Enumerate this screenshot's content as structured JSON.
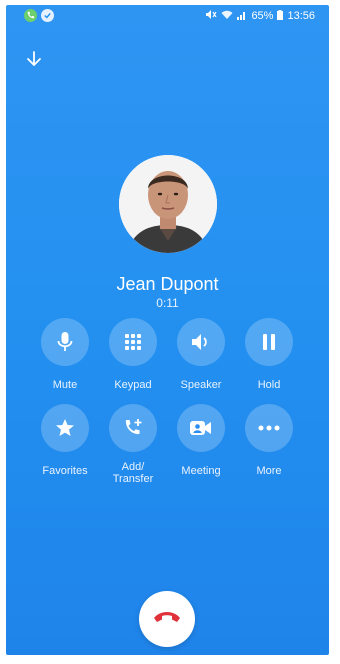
{
  "status_bar": {
    "battery": "65%",
    "time": "13:56"
  },
  "caller": {
    "name": "Jean Dupont",
    "duration": "0:11"
  },
  "controls_row1": [
    {
      "label": "Mute",
      "icon": "microphone-icon"
    },
    {
      "label": "Keypad",
      "icon": "keypad-icon"
    },
    {
      "label": "Speaker",
      "icon": "speaker-icon"
    },
    {
      "label": "Hold",
      "icon": "pause-icon"
    }
  ],
  "controls_row2": [
    {
      "label": "Favorites",
      "icon": "star-icon"
    },
    {
      "label": "Add/\nTransfer",
      "icon": "add-call-icon"
    },
    {
      "label": "Meeting",
      "icon": "video-icon"
    },
    {
      "label": "More",
      "icon": "more-icon"
    }
  ],
  "colors": {
    "background": "#2390f0",
    "hangup_icon": "#e0323a"
  }
}
